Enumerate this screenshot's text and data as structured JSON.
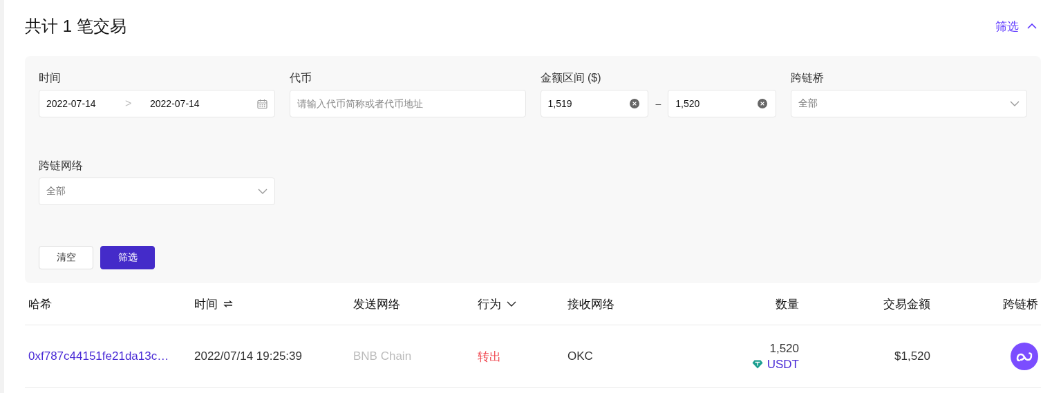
{
  "header": {
    "title": "共计 1 笔交易",
    "filter_toggle": {
      "label": "筛选",
      "expanded": true
    }
  },
  "filters": {
    "fields": [
      {
        "kind": "daterange",
        "label": "时间",
        "start": "2022-07-14",
        "separator": ">",
        "end": "2022-07-14"
      },
      {
        "kind": "text",
        "label": "代币",
        "placeholder": "请输入代币简称或者代币地址"
      },
      {
        "kind": "range",
        "label": "金额区间 ($)",
        "min": "1,519",
        "separator": "–",
        "max": "1,520"
      },
      {
        "kind": "select",
        "label": "跨链桥",
        "value": "全部"
      },
      {
        "kind": "select",
        "label": "跨链网络",
        "value": "全部"
      }
    ],
    "buttons": [
      {
        "label": "清空",
        "primary": false
      },
      {
        "label": "筛选",
        "primary": true
      }
    ]
  },
  "table": {
    "columns": [
      {
        "label": "哈希",
        "kind": "text"
      },
      {
        "label": "时间",
        "kind": "sort"
      },
      {
        "label": "发送网络",
        "kind": "text"
      },
      {
        "label": "行为",
        "kind": "menu"
      },
      {
        "label": "接收网络",
        "kind": "text"
      },
      {
        "label": "数量",
        "kind": "number"
      },
      {
        "label": "交易金额",
        "kind": "number"
      },
      {
        "label": "跨链桥",
        "kind": "icon"
      }
    ],
    "rows": [
      {
        "hash": "0xf787c44151fe21da13c…",
        "time": "2022/07/14 19:25:39",
        "send_network": "BNB Chain",
        "action": {
          "label": "转出",
          "outgoing": true
        },
        "receive_network": "OKC",
        "quantity": "1,520",
        "token": "USDT",
        "amount": "$1,520"
      }
    ]
  }
}
